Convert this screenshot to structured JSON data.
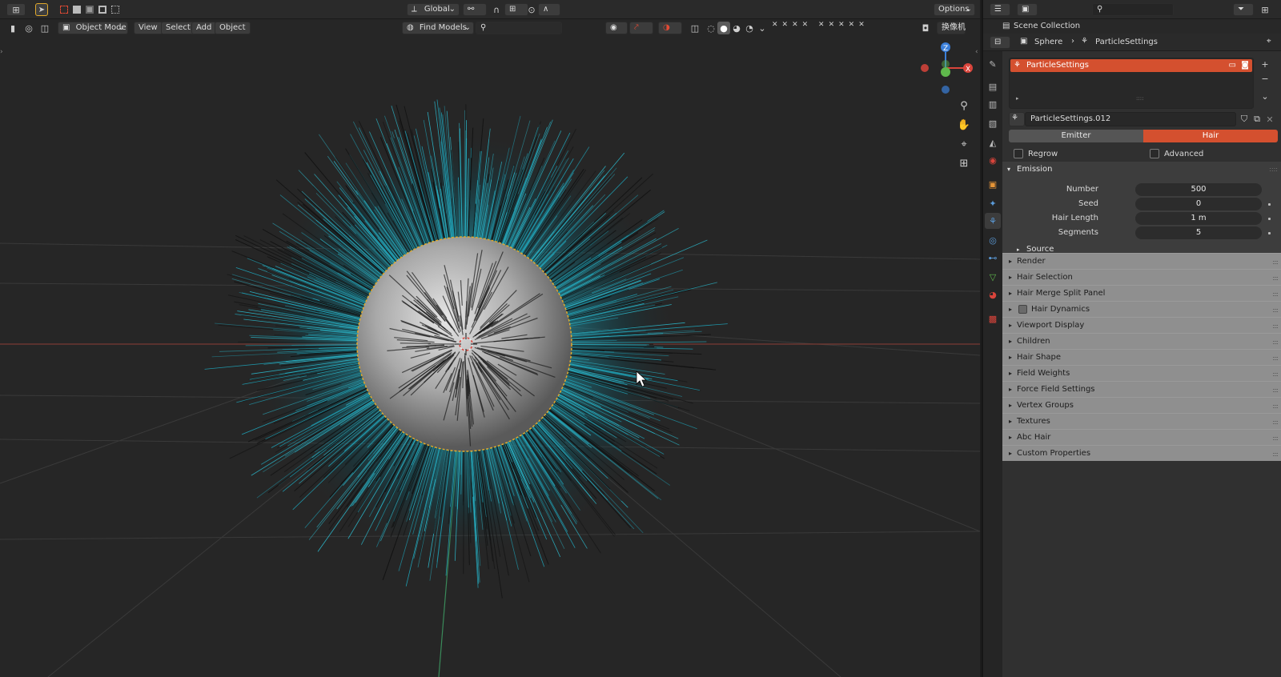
{
  "viewport_header": {
    "orientation": "Global",
    "options": "Options"
  },
  "viewport_toolbar": {
    "mode": "Object Mode",
    "menu": [
      "View",
      "Select",
      "Add",
      "Object"
    ],
    "find_models": "Find Models",
    "camera_btn": "换像机"
  },
  "outliner": {
    "scene_collection": "Scene Collection"
  },
  "properties": {
    "breadcrumb": {
      "object": "Sphere",
      "data": "ParticleSettings"
    },
    "slot": "ParticleSettings",
    "settings_name": "ParticleSettings.012",
    "type_tabs": [
      "Emitter",
      "Hair"
    ],
    "active_type": "Hair",
    "regrow": "Regrow",
    "advanced": "Advanced",
    "emission": {
      "title": "Emission",
      "fields": [
        {
          "label": "Number",
          "value": "500"
        },
        {
          "label": "Seed",
          "value": "0"
        },
        {
          "label": "Hair Length",
          "value": "1 m"
        },
        {
          "label": "Segments",
          "value": "5"
        }
      ],
      "source": "Source"
    },
    "panels": [
      "Render",
      "Hair Selection",
      "Hair Merge Split Panel",
      "Hair Dynamics",
      "Viewport Display",
      "Children",
      "Hair Shape",
      "Field Weights",
      "Force Field Settings",
      "Vertex Groups",
      "Textures",
      "Abc Hair",
      "Custom Properties"
    ]
  },
  "gizmo": {
    "z": "Z",
    "x": "X"
  },
  "colors": {
    "accent": "#d4502f",
    "selection": "#e1a92c",
    "hair": "#1fa3b8",
    "x_axis": "#d9443b",
    "y_axis": "#5fb84c",
    "z_axis": "#3b7fd9"
  }
}
